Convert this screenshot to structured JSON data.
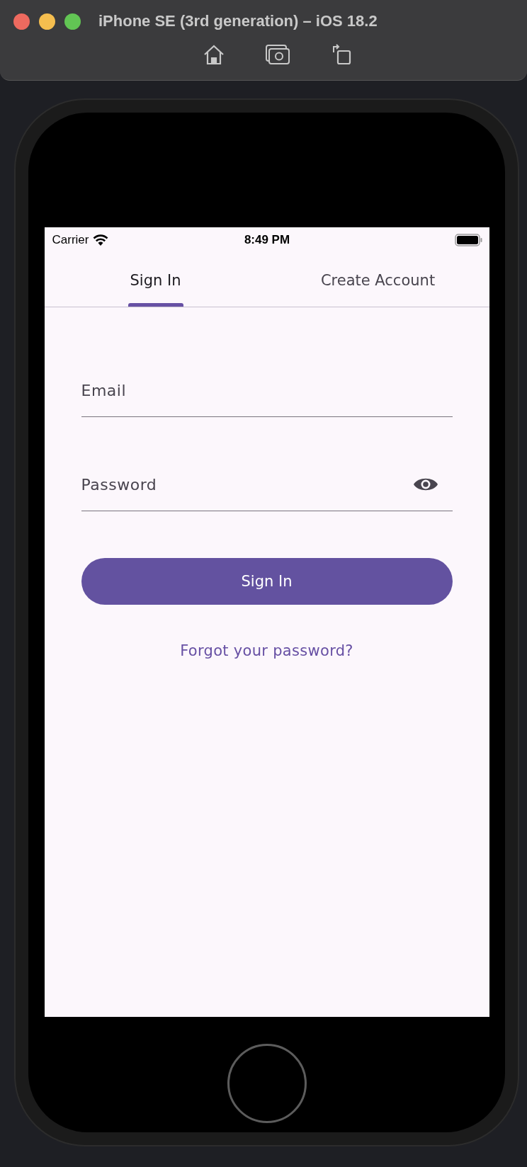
{
  "window": {
    "title": "iPhone SE (3rd generation) – iOS 18.2"
  },
  "status_bar": {
    "carrier": "Carrier",
    "time": "8:49 PM"
  },
  "tabs": [
    {
      "label": "Sign In",
      "selected": true
    },
    {
      "label": "Create Account",
      "selected": false
    }
  ],
  "fields": [
    {
      "label": "Email",
      "kind": "text"
    },
    {
      "label": "Password",
      "kind": "password"
    }
  ],
  "submit_button": {
    "label": "Sign In"
  },
  "forgot_link": {
    "label": "Forgot your password?"
  }
}
